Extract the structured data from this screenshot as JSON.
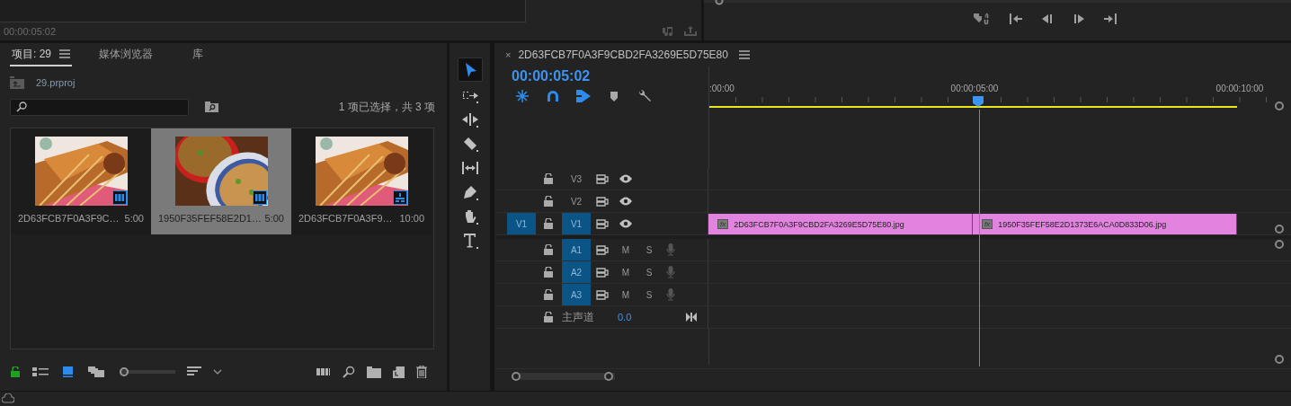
{
  "source_monitor": {
    "timecode": "00:00:05:02"
  },
  "project_panel": {
    "tabs": [
      {
        "label": "项目: 29",
        "selected": true
      },
      {
        "label": "媒体浏览器",
        "selected": false
      },
      {
        "label": "库",
        "selected": false
      }
    ],
    "project_file": "29.prproj",
    "selection_summary": "1 项已选择，共 3 项",
    "items": [
      {
        "name": "2D63FCB7F0A3F9C…",
        "duration": "5:00",
        "selected": false,
        "kind": "clip"
      },
      {
        "name": "1950F35FEF58E2D1…",
        "duration": "5:00",
        "selected": true,
        "kind": "clip"
      },
      {
        "name": "2D63FCB7F0A3F9…",
        "duration": "10:00",
        "selected": false,
        "kind": "sequence"
      }
    ],
    "views": [
      {
        "kind": "list",
        "selected": false
      },
      {
        "kind": "icon",
        "selected": true
      },
      {
        "kind": "freeform",
        "selected": false
      }
    ],
    "zoom": {
      "level": 0
    }
  },
  "tools": [
    {
      "kind": "selection",
      "selected": true
    },
    {
      "kind": "track-select",
      "selected": false
    },
    {
      "kind": "ripple",
      "selected": false
    },
    {
      "kind": "razor",
      "selected": false
    },
    {
      "kind": "slip",
      "selected": false
    },
    {
      "kind": "pen",
      "selected": false
    },
    {
      "kind": "hand",
      "selected": false
    },
    {
      "kind": "type",
      "selected": false
    }
  ],
  "timeline": {
    "close": "×",
    "title": "2D63FCB7F0A3F9CBD2FA3269E5D75E80",
    "timecode": "00:00:05:02",
    "toolbar": [
      {
        "kind": "nest",
        "on": true
      },
      {
        "kind": "snap",
        "on": true
      },
      {
        "kind": "linked",
        "on": true
      },
      {
        "kind": "marker",
        "on": false
      },
      {
        "kind": "settings",
        "on": false
      }
    ],
    "ruler_labels": [
      ":00:00",
      "00:00:05:00",
      "00:00:10:00"
    ],
    "playhead": {
      "level": 0.48
    },
    "video_tracks": [
      {
        "name": "V3",
        "targeted": false
      },
      {
        "name": "V2",
        "targeted": false
      },
      {
        "name": "V1",
        "targeted": true,
        "source": "V1",
        "clips": [
          {
            "badge": "fx",
            "name": "2D63FCB7F0A3F9CBD2FA3269E5D75E80.jpg"
          },
          {
            "badge": "fx",
            "name": "1950F35FEF58E2D1373E6ACA0D833D06.jpg"
          }
        ]
      }
    ],
    "audio_tracks": [
      {
        "name": "A1",
        "targeted": true,
        "mute": "M",
        "solo": "S"
      },
      {
        "name": "A2",
        "targeted": true,
        "mute": "M",
        "solo": "S"
      },
      {
        "name": "A3",
        "targeted": true,
        "mute": "M",
        "solo": "S"
      }
    ],
    "master": {
      "label": "主声道",
      "volume": "0.0"
    }
  }
}
